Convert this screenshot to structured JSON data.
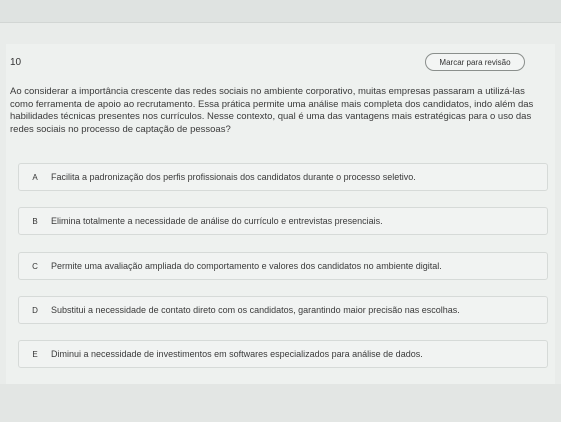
{
  "question": {
    "number": "10",
    "review_label": "Marcar para revisão",
    "text": "Ao considerar a importância crescente das redes sociais no ambiente corporativo, muitas empresas passaram a utilizá-las como ferramenta de apoio ao recrutamento. Essa prática permite uma análise mais completa dos candidatos, indo além das habilidades técnicas presentes nos currículos. Nesse contexto, qual é uma das vantagens mais estratégicas para o uso das redes sociais no processo de captação de pessoas?"
  },
  "options": [
    {
      "letter": "A",
      "text": "Facilita a padronização dos perfis profissionais dos candidatos durante o processo seletivo."
    },
    {
      "letter": "B",
      "text": "Elimina totalmente a necessidade de análise do currículo e entrevistas presenciais."
    },
    {
      "letter": "C",
      "text": "Permite uma avaliação ampliada do comportamento e valores dos candidatos no ambiente digital."
    },
    {
      "letter": "D",
      "text": "Substitui a necessidade de contato direto com os candidatos, garantindo maior precisão nas escolhas."
    },
    {
      "letter": "E",
      "text": "Diminui a necessidade de investimentos em softwares especializados para análise de dados."
    }
  ]
}
